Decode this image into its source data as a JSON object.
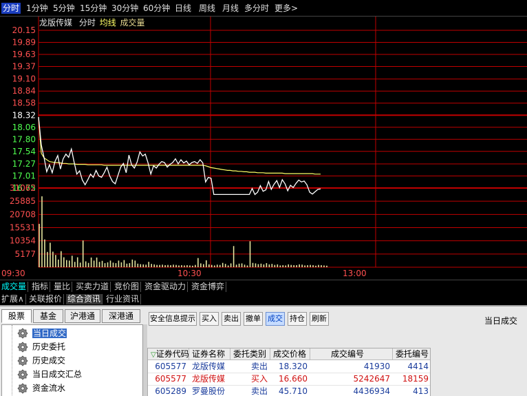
{
  "periods": [
    "分时",
    "1分钟",
    "5分钟",
    "15分钟",
    "30分钟",
    "60分钟",
    "日线",
    "周线",
    "月线",
    "多分时",
    "更多>"
  ],
  "stock_header": {
    "name": "龙版传媒",
    "mode": "分时",
    "avg_label": "均线",
    "vol_label": "成交量"
  },
  "chart_data": [
    {
      "type": "line",
      "y_ticks": [
        "20.15",
        "19.89",
        "19.63",
        "19.37",
        "19.10",
        "18.84",
        "18.58",
        "18.32",
        "18.06",
        "17.80",
        "17.54",
        "17.27",
        "17.01",
        "16.75"
      ],
      "ylim": [
        16.75,
        20.15
      ],
      "x_ticks": [
        "09:30",
        "10:30",
        "13:00"
      ],
      "series": [
        {
          "values": [
            18.28,
            17.68,
            17.41,
            17.1,
            17.25,
            17.08,
            17.32,
            17.45,
            17.16,
            17.38,
            17.48,
            17.41,
            17.59,
            17.31,
            17.05,
            17.12,
            16.92,
            16.82,
            16.93,
            17.05,
            16.98,
            17.13,
            17.01,
            16.98,
            17.08,
            17.2,
            17.01,
            16.89,
            16.84,
            17.02,
            17.2,
            17.28,
            17.08,
            17.46,
            17.25,
            17.18,
            17.31,
            17.53,
            17.44,
            17.48,
            17.29,
            17.05,
            17.23,
            17.18,
            17.26,
            17.32,
            17.3,
            17.2,
            17.26,
            17.3,
            17.38,
            17.27,
            17.36,
            17.29,
            17.33,
            17.25,
            17.3,
            17.32,
            17.28,
            17.36,
            17.29,
            16.88,
            16.98,
            16.96,
            16.61,
            16.61,
            16.61,
            16.61,
            16.61,
            16.61,
            16.61,
            16.61,
            16.61,
            16.61,
            16.61,
            16.61,
            16.61,
            16.61,
            16.74,
            16.61,
            16.66,
            16.8,
            16.68,
            16.71,
            16.89,
            16.72,
            16.83,
            16.91,
            16.76,
            16.93,
            16.84,
            16.69,
            16.81,
            16.76,
            16.85,
            16.92,
            16.88,
            16.9,
            16.82,
            16.66,
            16.62,
            16.67,
            16.72,
            16.73
          ]
        },
        {
          "values": [
            18.28,
            17.5,
            17.4,
            17.36,
            17.32,
            17.31,
            17.3,
            17.3,
            17.29,
            17.28,
            17.28,
            17.27,
            17.27,
            17.27,
            17.26,
            17.26,
            17.26,
            17.26,
            17.25,
            17.25,
            17.25,
            17.25,
            17.25,
            17.25,
            17.24,
            17.24,
            17.24,
            17.24,
            17.24,
            17.24,
            17.24,
            17.24,
            17.24,
            17.24,
            17.24,
            17.24,
            17.24,
            17.24,
            17.24,
            17.24,
            17.24,
            17.24,
            17.24,
            17.24,
            17.24,
            17.24,
            17.24,
            17.24,
            17.24,
            17.24,
            17.24,
            17.24,
            17.24,
            17.24,
            17.24,
            17.24,
            17.24,
            17.24,
            17.24,
            17.24,
            17.24,
            17.23,
            17.21,
            17.19,
            17.18,
            17.17,
            17.16,
            17.15,
            17.14,
            17.13,
            17.13,
            17.12,
            17.12,
            17.11,
            17.11,
            17.1,
            17.1,
            17.09,
            17.09,
            17.09,
            17.08,
            17.08,
            17.08,
            17.07,
            17.07,
            17.07,
            17.07,
            17.07,
            17.07,
            17.07,
            17.06,
            17.06,
            17.06,
            17.06,
            17.06,
            17.06,
            17.06,
            17.06,
            17.06,
            17.06,
            17.06,
            17.05,
            17.05,
            17.05
          ]
        }
      ]
    },
    {
      "type": "bar",
      "y_ticks": [
        "31062",
        "25885",
        "20708",
        "15531",
        "10354",
        "5177"
      ],
      "ylim": [
        0,
        31062
      ],
      "values": [
        17000,
        27800,
        10900,
        6000,
        9600,
        6100,
        4800,
        3000,
        6300,
        3900,
        2800,
        2600,
        4500,
        2100,
        3900,
        1800,
        10500,
        2300,
        1700,
        3800,
        2600,
        3800,
        2100,
        2500,
        1600,
        1900,
        2600,
        1800,
        1600,
        2600,
        1900,
        2800,
        1400,
        1600,
        3000,
        2600,
        1400,
        1200,
        1100,
        1000,
        2100,
        1300,
        1100,
        900,
        900,
        1000,
        800,
        900,
        800,
        1000,
        900,
        700,
        800,
        700,
        800,
        700,
        600,
        900,
        3600,
        1500,
        1200,
        2700,
        1100,
        900,
        700,
        1000,
        900,
        1700,
        1300,
        700,
        1500,
        8300,
        1000,
        1400,
        1500,
        1000,
        700,
        10200,
        1700,
        1500,
        1200,
        1400,
        1100,
        1600,
        1100,
        1300,
        900,
        1100,
        700,
        800,
        700,
        1100,
        900,
        800,
        800,
        1100,
        1000,
        700,
        800,
        900,
        800,
        600,
        900,
        800,
        700,
        600
      ]
    }
  ],
  "tabs_row1": [
    "成交量",
    "指标",
    "量比",
    "买卖力道",
    "竞价图",
    "资金驱动力",
    "资金博弈"
  ],
  "tabs_row2": [
    "扩展∧",
    "关联报价",
    "综合资讯",
    "行业资讯"
  ],
  "market_tabs": [
    "股票",
    "基金",
    "沪港通",
    "深港通"
  ],
  "tree": [
    "当日成交",
    "历史委托",
    "历史成交",
    "当日成交汇总",
    "资金流水"
  ],
  "toolbar": [
    "安全信息提示",
    "买入",
    "卖出",
    "撤单",
    "成交",
    "持仓",
    "刷新"
  ],
  "panel_title": "当日成交",
  "table": {
    "sort_mark": "▽",
    "columns": [
      "证券代码",
      "证券名称",
      "委托类别",
      "成交价格",
      "成交编号",
      "委托编号"
    ],
    "rows": [
      {
        "code": "605577",
        "name": "龙版传媒",
        "side": "卖出",
        "price": "18.320",
        "trade_no": "41930",
        "order_no": "4414",
        "color": "#1a3c9c"
      },
      {
        "code": "605577",
        "name": "龙版传媒",
        "side": "买入",
        "price": "16.660",
        "trade_no": "5242647",
        "order_no": "18159",
        "color": "#d01010"
      },
      {
        "code": "605289",
        "name": "罗曼股份",
        "side": "卖出",
        "price": "45.710",
        "trade_no": "4436934",
        "order_no": "413",
        "color": "#1a3c9c"
      }
    ]
  },
  "colors": {
    "grid": "#c00000",
    "price_line": "#ffffff",
    "avg_line": "#ffff66",
    "vol_bar": "#e6e6a0",
    "up_label": "#ff5050",
    "down_label": "#50ff50",
    "mid_label": "#ffffff"
  }
}
